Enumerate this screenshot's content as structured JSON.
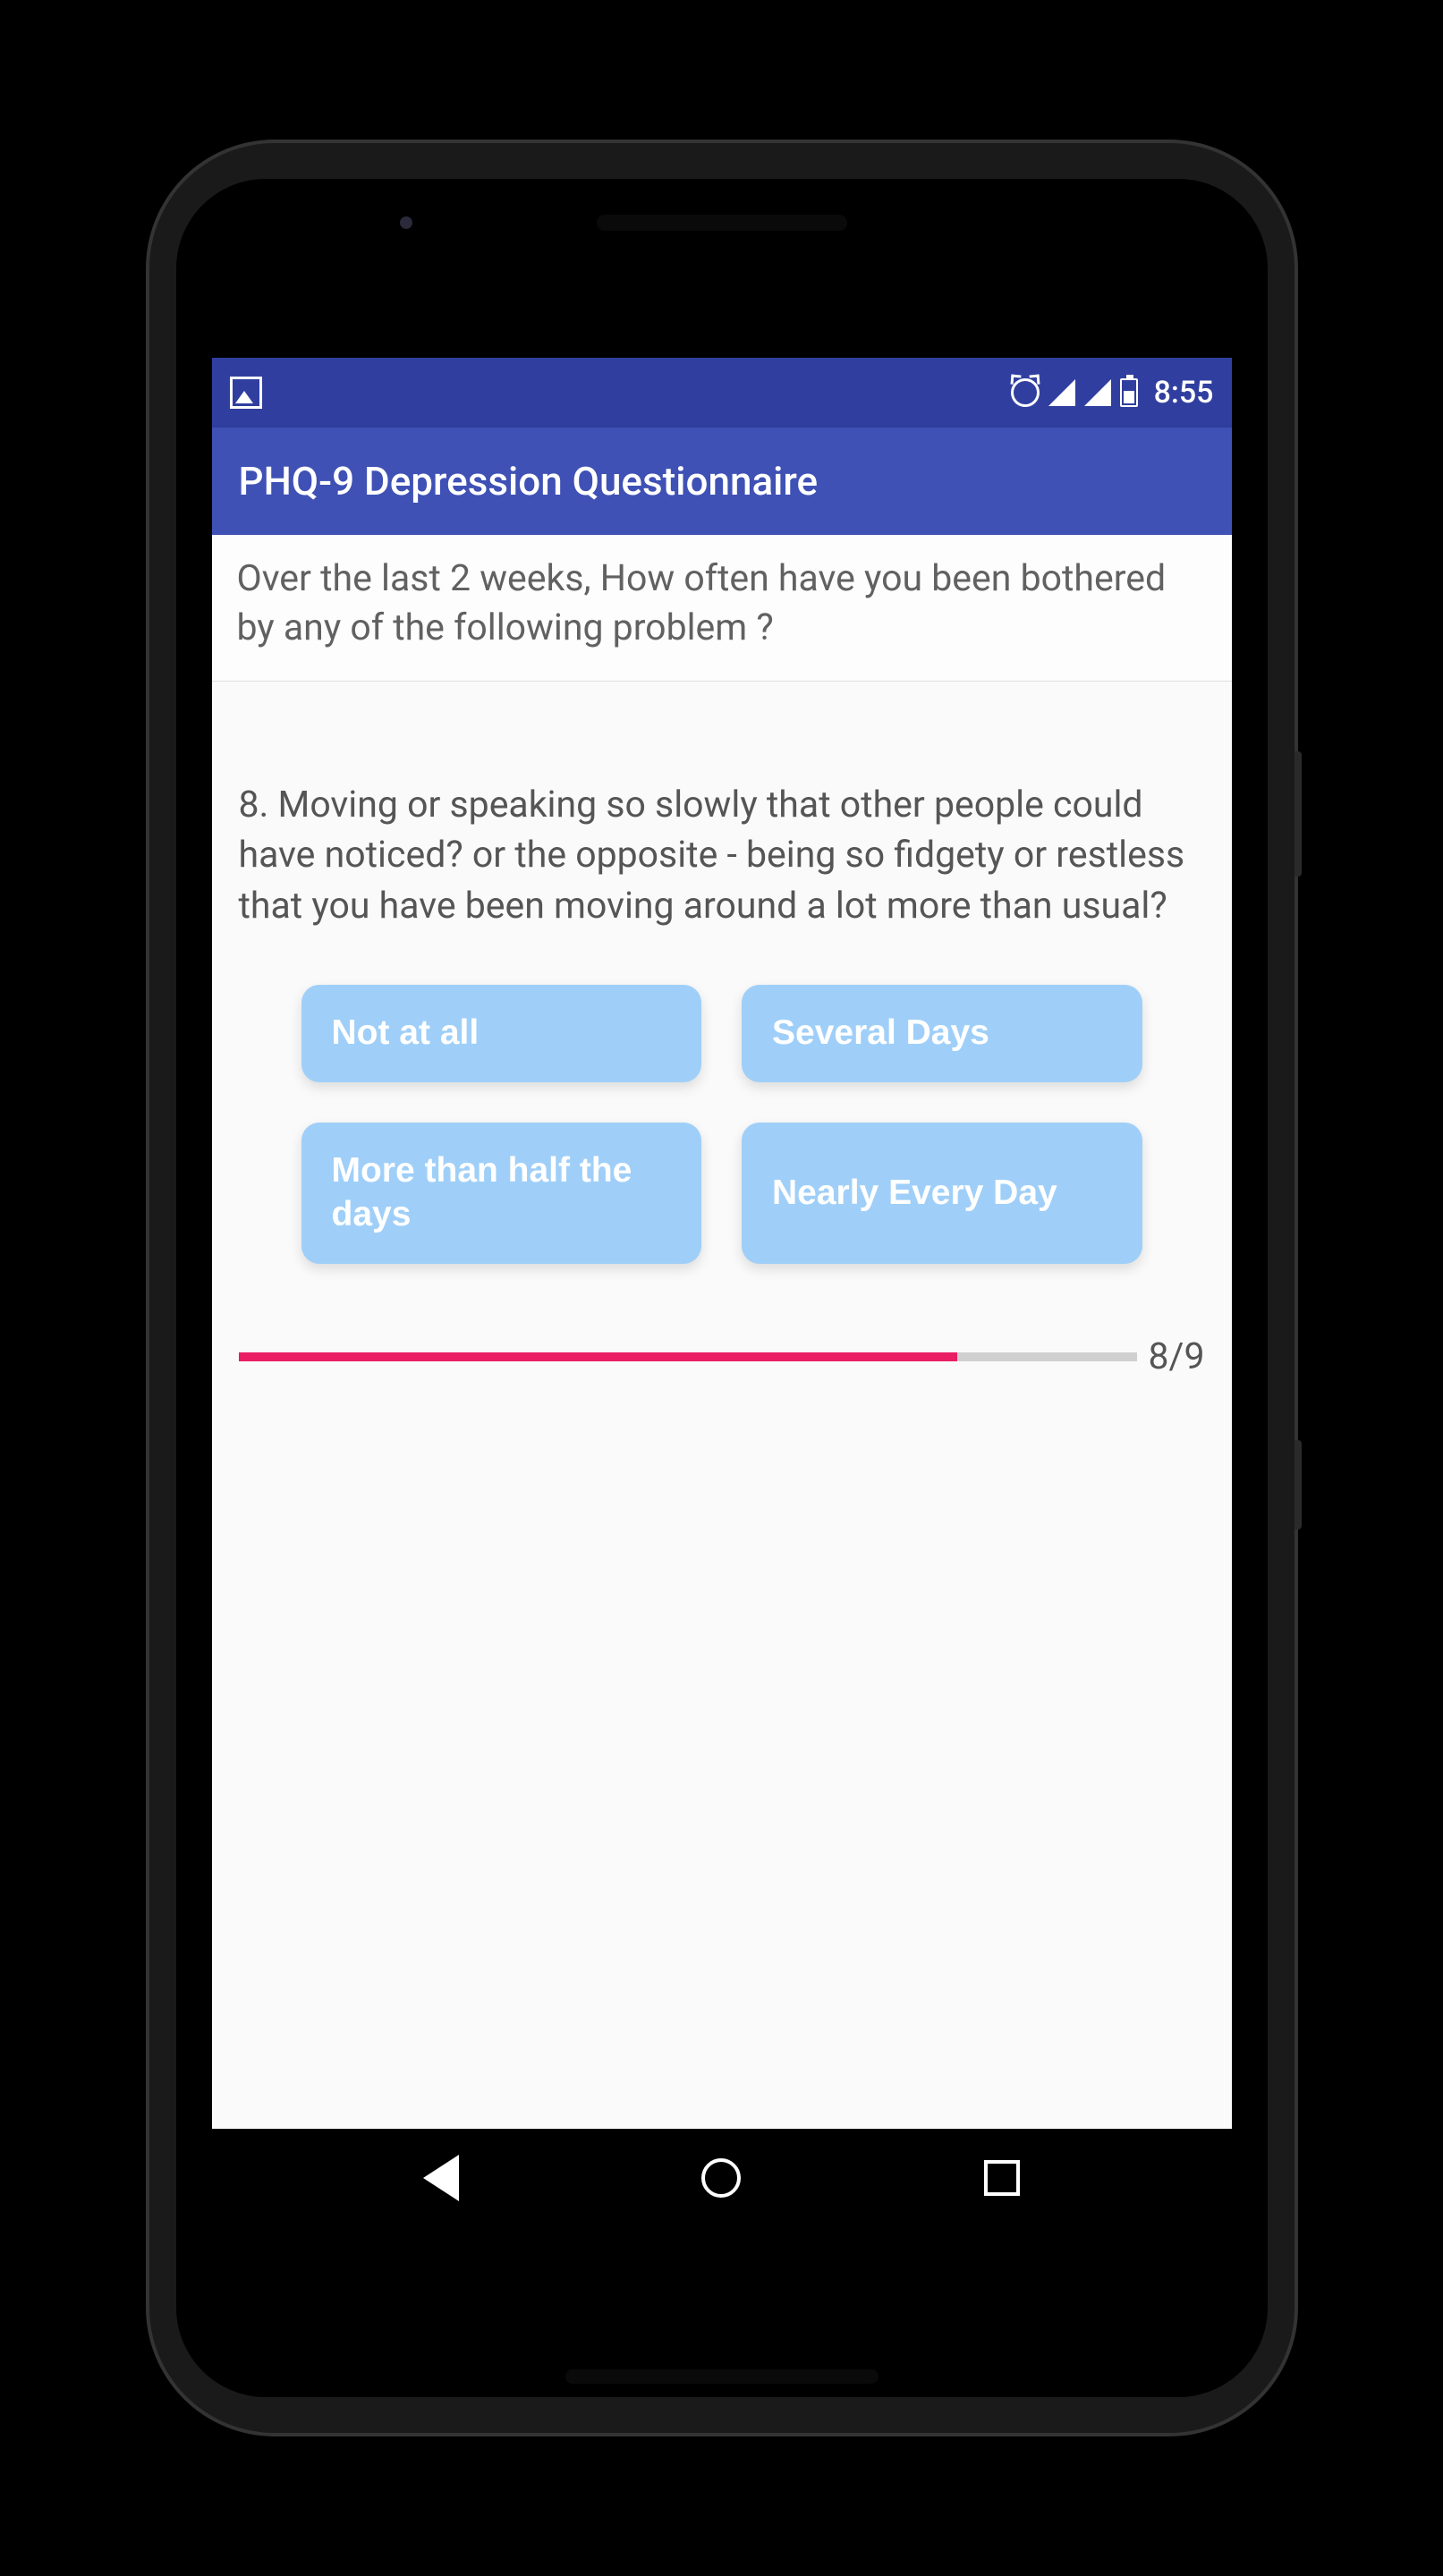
{
  "status_bar": {
    "time": "8:55"
  },
  "app_bar": {
    "title": "PHQ-9 Depression Questionnaire"
  },
  "intro": {
    "text": "Over the last 2 weeks, How often have you been bothered by any of the following problem ?"
  },
  "question": {
    "number": 8,
    "text": "8. Moving or speaking so slowly that other people could have noticed? or the opposite - being so fidgety or restless that you have been moving around a lot more than usual?"
  },
  "answers": [
    {
      "label": "Not at all"
    },
    {
      "label": "Several Days"
    },
    {
      "label": "More than half the days"
    },
    {
      "label": "Nearly Every Day"
    }
  ],
  "progress": {
    "current": 8,
    "total": 9,
    "label": "8/9",
    "percent": 80
  },
  "colors": {
    "primary": "#3F51B5",
    "primary_dark": "#303F9F",
    "answer_bg": "#9FCFF8",
    "progress_fill": "#E91E63"
  }
}
